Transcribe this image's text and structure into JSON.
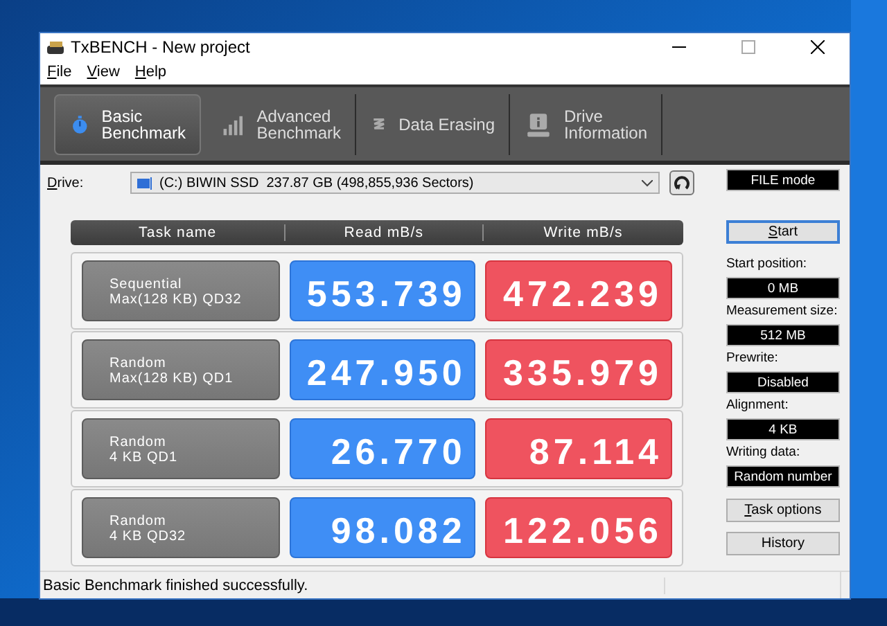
{
  "window": {
    "title": "TxBENCH - New project"
  },
  "menu": [
    "File",
    "View",
    "Help"
  ],
  "tabs": [
    {
      "lines": [
        "Basic",
        "Benchmark"
      ],
      "selected": true
    },
    {
      "lines": [
        "Advanced",
        "Benchmark"
      ],
      "selected": false
    },
    {
      "lines": [
        "Data Erasing"
      ],
      "selected": false
    },
    {
      "lines": [
        "Drive",
        "Information"
      ],
      "selected": false
    }
  ],
  "drive": {
    "label": "Drive:",
    "value": "(C:) BIWIN SSD  237.87 GB (498,855,936 Sectors)"
  },
  "mode": "FILE mode",
  "table": {
    "columns": [
      "Task name",
      "Read mB/s",
      "Write mB/s"
    ],
    "rows": [
      {
        "task": [
          "Sequential",
          "Max(128 KB) QD32"
        ],
        "read": "553.739",
        "write": "472.239"
      },
      {
        "task": [
          "Random",
          "Max(128 KB) QD1"
        ],
        "read": "247.950",
        "write": "335.979"
      },
      {
        "task": [
          "Random",
          "4 KB QD1"
        ],
        "read": "26.770",
        "write": "87.114"
      },
      {
        "task": [
          "Random",
          "4 KB QD32"
        ],
        "read": "98.082",
        "write": "122.056"
      }
    ]
  },
  "start_button": "Start",
  "settings": [
    {
      "label": "Start position:",
      "value": "0 MB"
    },
    {
      "label": "Measurement size:",
      "value": "512 MB"
    },
    {
      "label": "Prewrite:",
      "value": "Disabled"
    },
    {
      "label": "Alignment:",
      "value": "4 KB"
    },
    {
      "label": "Writing data:",
      "value": "Random number"
    }
  ],
  "buttons": [
    "Task options",
    "History"
  ],
  "status_bar": "Basic Benchmark finished successfully."
}
